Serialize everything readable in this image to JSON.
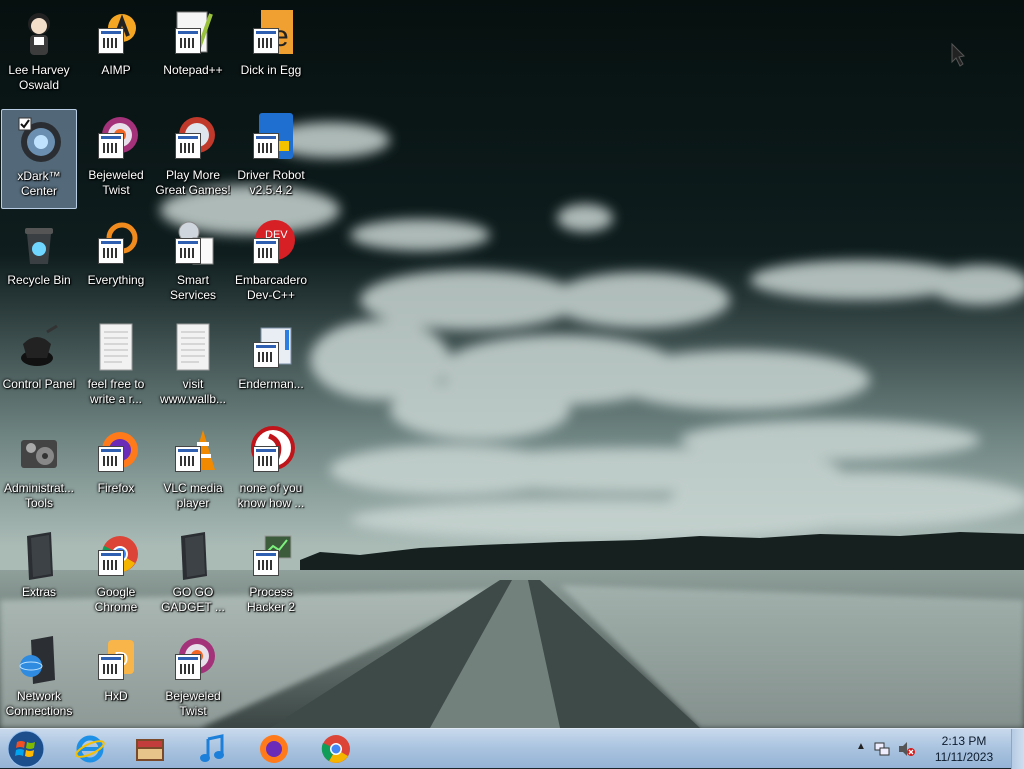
{
  "desktop": {
    "icons": [
      {
        "label": "Lee Harvey Oswald",
        "icon": "anime-avatar-icon"
      },
      {
        "label": "AIMP",
        "icon": "aimp-icon"
      },
      {
        "label": "Notepad++",
        "icon": "notepadpp-icon"
      },
      {
        "label": "Dick in Egg",
        "icon": "dick-in-egg-icon"
      },
      {
        "label": "xDark™ Center",
        "icon": "xdark-center-icon",
        "selected": true
      },
      {
        "label": "Bejeweled Twist",
        "icon": "bejeweled-icon"
      },
      {
        "label": "Play More Great Games!",
        "icon": "games-icon"
      },
      {
        "label": "Driver Robot v2.5.4.2",
        "icon": "driver-robot-icon"
      },
      {
        "label": "Recycle Bin",
        "icon": "recycle-bin-icon"
      },
      {
        "label": "Everything",
        "icon": "everything-search-icon"
      },
      {
        "label": "Smart Services",
        "icon": "smart-services-icon"
      },
      {
        "label": "Embarcadero Dev-C++",
        "icon": "devcpp-icon"
      },
      {
        "label": "Control Panel",
        "icon": "control-panel-icon"
      },
      {
        "label": "feel free to write a r...",
        "icon": "text-document-icon"
      },
      {
        "label": "visit www.wallb...",
        "icon": "text-document-icon"
      },
      {
        "label": "Enderman...",
        "icon": "shortcut-icon"
      },
      {
        "label": "Administrat... Tools",
        "icon": "admin-tools-icon"
      },
      {
        "label": "Firefox",
        "icon": "firefox-icon"
      },
      {
        "label": "VLC media player",
        "icon": "vlc-icon"
      },
      {
        "label": "none of you know how ...",
        "icon": "red-app-icon"
      },
      {
        "label": "Extras",
        "icon": "folder-icon"
      },
      {
        "label": "Google Chrome",
        "icon": "chrome-icon"
      },
      {
        "label": "GO GO GADGET ...",
        "icon": "folder-icon"
      },
      {
        "label": "Process Hacker 2",
        "icon": "process-hacker-icon"
      },
      {
        "label": "Network Connections",
        "icon": "network-icon"
      },
      {
        "label": "HxD",
        "icon": "hxd-icon"
      },
      {
        "label": "Bejeweled Twist",
        "icon": "bejeweled-icon"
      }
    ]
  },
  "taskbar": {
    "start_icon": "windows-start-icon",
    "pinned": [
      {
        "icon": "internet-explorer-icon"
      },
      {
        "icon": "windows-explorer-icon"
      },
      {
        "icon": "music-player-icon"
      },
      {
        "icon": "firefox-icon"
      },
      {
        "icon": "chrome-icon"
      }
    ],
    "tray": {
      "overflow_icon": "show-hidden-icons-icon",
      "network_icon": "network-tray-icon",
      "volume_icon": "volume-muted-icon",
      "time": "2:13 PM",
      "date": "11/11/2023"
    }
  },
  "colors": {
    "taskbar": "#a9c3df",
    "sky": "#0b1416",
    "label": "#ffffff"
  }
}
